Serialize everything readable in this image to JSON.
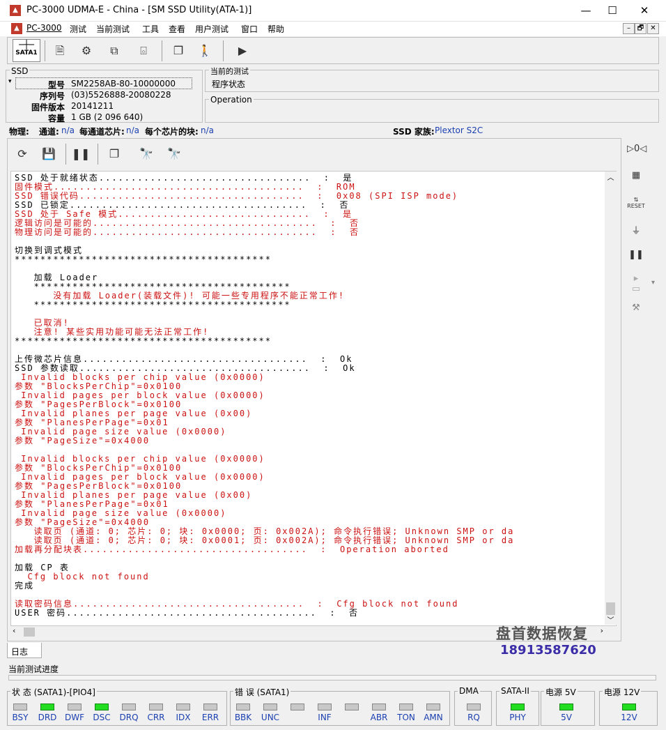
{
  "window": {
    "title": "PC-3000 UDMA-E - China - [SM SSD Utility(ATA-1)]",
    "minimize": "—",
    "maximize": "☐",
    "close": "✕"
  },
  "menu": [
    "PC-3000",
    "测试",
    "当前测试",
    "工具",
    "查看",
    "用户测试",
    "窗口",
    "帮助"
  ],
  "mdi_buttons": [
    "–",
    "🗗",
    "✕"
  ],
  "toolbar": {
    "sata_label": "SATA1"
  },
  "ssd": {
    "group_label": "SSD",
    "model_label": "型号",
    "model_value": "SM2258AB-80-10000000",
    "serial_label": "序列号",
    "serial_value": "(03)5526888-20080228",
    "firmware_label": "固件版本",
    "firmware_value": "20141211",
    "capacity_label": "容量",
    "capacity_value": "1 GB (2 096 640)"
  },
  "current_test": {
    "label": "当前的测试",
    "value": "程序状态",
    "operation_label": "Operation"
  },
  "physical": {
    "label": "物理:",
    "channels_label": "通道:",
    "channels_value": "n/a",
    "chips_label": "每通道芯片:",
    "chips_value": "n/a",
    "blocks_label": "每个芯片的块:",
    "blocks_value": "n/a",
    "family_label": "SSD 家族:",
    "family_value": "Plextor S2C"
  },
  "log_lines": [
    {
      "t": "SSD 处于就绪状态.................................  :  是",
      "c": "black"
    },
    {
      "t": "固件模式.......................................  :  ROM",
      "c": "red"
    },
    {
      "t": "SSD 错误代码...................................  :  0x08 (SPI ISP mode)",
      "c": "red"
    },
    {
      "t": "SSD 已锁定.....................................  :  否",
      "c": "black"
    },
    {
      "t": "SSD 处于 Safe 模式..............................  :  是",
      "c": "red"
    },
    {
      "t": "逻辑访问是可能的...................................  :  否",
      "c": "red"
    },
    {
      "t": "物理访问是可能的...................................  :  否",
      "c": "red"
    },
    {
      "t": "",
      "c": "black"
    },
    {
      "t": "切换到调式模式",
      "c": "black"
    },
    {
      "t": "****************************************",
      "c": "black"
    },
    {
      "t": "",
      "c": "black"
    },
    {
      "t": "   加载 Loader",
      "c": "black"
    },
    {
      "t": "   ****************************************",
      "c": "black"
    },
    {
      "t": "      没有加载 Loader(装载文件)! 可能一些专用程序不能正常工作!",
      "c": "red"
    },
    {
      "t": "   ****************************************",
      "c": "black"
    },
    {
      "t": "",
      "c": "black"
    },
    {
      "t": "   已取消!",
      "c": "red"
    },
    {
      "t": "   注意! 某些实用功能可能无法正常工作!",
      "c": "red"
    },
    {
      "t": "****************************************",
      "c": "black"
    },
    {
      "t": "",
      "c": "black"
    },
    {
      "t": "上传微芯片信息...................................  :  Ok",
      "c": "black"
    },
    {
      "t": "SSD 参数读取....................................  :  Ok",
      "c": "black"
    },
    {
      "t": " Invalid blocks per chip value (0x0000)",
      "c": "red"
    },
    {
      "t": "参数 \"BlocksPerChip\"=0x0100",
      "c": "red"
    },
    {
      "t": " Invalid pages per block value (0x0000)",
      "c": "red"
    },
    {
      "t": "参数 \"PagesPerBlock\"=0x0100",
      "c": "red"
    },
    {
      "t": " Invalid planes per page value (0x00)",
      "c": "red"
    },
    {
      "t": "参数 \"PlanesPerPage\"=0x01",
      "c": "red"
    },
    {
      "t": " Invalid page size value (0x0000)",
      "c": "red"
    },
    {
      "t": "参数 \"PageSize\"=0x4000",
      "c": "red"
    },
    {
      "t": "",
      "c": "black"
    },
    {
      "t": " Invalid blocks per chip value (0x0000)",
      "c": "red"
    },
    {
      "t": "参数 \"BlocksPerChip\"=0x0100",
      "c": "red"
    },
    {
      "t": " Invalid pages per block value (0x0000)",
      "c": "red"
    },
    {
      "t": "参数 \"PagesPerBlock\"=0x0100",
      "c": "red"
    },
    {
      "t": " Invalid planes per page value (0x00)",
      "c": "red"
    },
    {
      "t": "参数 \"PlanesPerPage\"=0x01",
      "c": "red"
    },
    {
      "t": " Invalid page size value (0x0000)",
      "c": "red"
    },
    {
      "t": "参数 \"PageSize\"=0x4000",
      "c": "red"
    },
    {
      "t": "   读取页 (通道: 0; 芯片: 0; 块: 0x0000; 页: 0x002A); 命令执行错误; Unknown SMP or da",
      "c": "red"
    },
    {
      "t": "   读取页 (通道: 0; 芯片: 0; 块: 0x0001; 页: 0x002A); 命令执行错误; Unknown SMP or da",
      "c": "red"
    },
    {
      "t": "加载再分配块表...................................  :  Operation aborted",
      "c": "red"
    },
    {
      "t": "",
      "c": "black"
    },
    {
      "t": "加载 CP 表",
      "c": "black"
    },
    {
      "t": "  Cfg block not found",
      "c": "red"
    },
    {
      "t": "完成",
      "c": "black"
    },
    {
      "t": "",
      "c": "black"
    },
    {
      "t": "读取密码信息....................................  :  Cfg block not found",
      "c": "red"
    },
    {
      "t": "USER 密码.......................................  :  否",
      "c": "black"
    }
  ],
  "log_tab": "日志",
  "progress_label": "当前测试进度",
  "watermark": {
    "line1": "盘首数据恢复",
    "line2": "18913587620"
  },
  "status": {
    "state_label": "状 态 (SATA1)-[PIO4]",
    "state_leds": [
      {
        "name": "BSY",
        "on": false
      },
      {
        "name": "DRD",
        "on": true
      },
      {
        "name": "DWF",
        "on": false
      },
      {
        "name": "DSC",
        "on": true
      },
      {
        "name": "DRQ",
        "on": false
      },
      {
        "name": "CRR",
        "on": false
      },
      {
        "name": "IDX",
        "on": false
      },
      {
        "name": "ERR",
        "on": false
      }
    ],
    "error_label": "错 误 (SATA1)",
    "error_leds": [
      {
        "name": "BBK",
        "on": false
      },
      {
        "name": "UNC",
        "on": false
      },
      {
        "name": "",
        "on": false
      },
      {
        "name": "INF",
        "on": false
      },
      {
        "name": "",
        "on": false
      },
      {
        "name": "ABR",
        "on": false
      },
      {
        "name": "TON",
        "on": false
      },
      {
        "name": "AMN",
        "on": false
      }
    ],
    "dma_label": "DMA",
    "dma_led": {
      "name": "RQ",
      "on": false
    },
    "sata_label": "SATA-II",
    "sata_led": {
      "name": "PHY",
      "on": true
    },
    "p5_label": "电源 5V",
    "p5_led": {
      "name": "5V",
      "on": true
    },
    "p12_label": "电源 12V",
    "p12_led": {
      "name": "12V",
      "on": true
    }
  }
}
